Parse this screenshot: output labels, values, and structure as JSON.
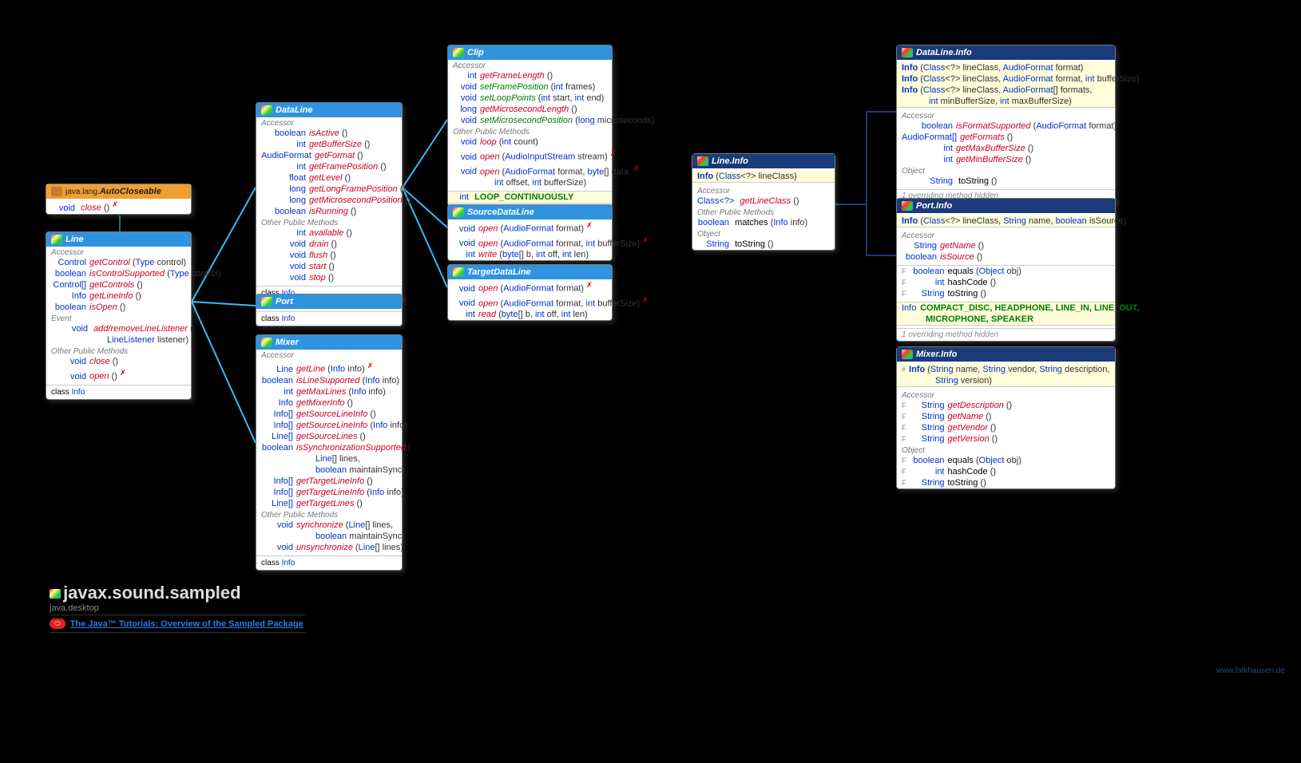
{
  "package": {
    "name": "javax.sound.sampled",
    "module": "java.desktop",
    "tutorial": "The Java™ Tutorials: Overview of the Sampled Package",
    "credit": "www.falkhausen.de"
  },
  "autocloseable": {
    "title_prefix": "java.lang.",
    "title": "AutoCloseable",
    "rows": [
      {
        "rt": "void",
        "nm": "close",
        "args": "()",
        "throws": true
      }
    ]
  },
  "line": {
    "title": "Line",
    "accessor": [
      {
        "rt": "Control",
        "nm": "getControl",
        "args": "(Type control)"
      },
      {
        "rt": "boolean",
        "nm": "isControlSupported",
        "args": "(Type control)"
      },
      {
        "rt": "Control[]",
        "nm": "getControls",
        "args": "()"
      },
      {
        "rt": "Info",
        "nm": "getLineInfo",
        "args": "()"
      },
      {
        "rt": "boolean",
        "nm": "isOpen",
        "args": "()"
      }
    ],
    "event": [
      {
        "rt": "void",
        "nm": "add/removeLineListener",
        "args": "(",
        "cont": "LineListener listener)"
      }
    ],
    "other": [
      {
        "rt": "void",
        "nm": "close",
        "args": "()"
      },
      {
        "rt": "void",
        "nm": "open",
        "args": "()",
        "throws": true
      }
    ],
    "footer": "Info"
  },
  "dataline": {
    "title": "DataLine",
    "accessor": [
      {
        "rt": "boolean",
        "nm": "isActive",
        "args": "()"
      },
      {
        "rt": "int",
        "nm": "getBufferSize",
        "args": "()"
      },
      {
        "rt": "AudioFormat",
        "nm": "getFormat",
        "args": "()"
      },
      {
        "rt": "int",
        "nm": "getFramePosition",
        "args": "()"
      },
      {
        "rt": "float",
        "nm": "getLevel",
        "args": "()"
      },
      {
        "rt": "long",
        "nm": "getLongFramePosition",
        "args": "()"
      },
      {
        "rt": "long",
        "nm": "getMicrosecondPosition",
        "args": "()"
      },
      {
        "rt": "boolean",
        "nm": "isRunning",
        "args": "()"
      }
    ],
    "other": [
      {
        "rt": "int",
        "nm": "available",
        "args": "()"
      },
      {
        "rt": "void",
        "nm": "drain",
        "args": "()"
      },
      {
        "rt": "void",
        "nm": "flush",
        "args": "()"
      },
      {
        "rt": "void",
        "nm": "start",
        "args": "()"
      },
      {
        "rt": "void",
        "nm": "stop",
        "args": "()"
      }
    ],
    "footer": "Info"
  },
  "port": {
    "title": "Port",
    "footer": "Info"
  },
  "mixer": {
    "title": "Mixer",
    "accessor": [
      {
        "rt": "Line",
        "nm": "getLine",
        "args": "(Info info)",
        "throws": true
      },
      {
        "rt": "boolean",
        "nm": "isLineSupported",
        "args": "(Info info)"
      },
      {
        "rt": "int",
        "nm": "getMaxLines",
        "args": "(Info info)"
      },
      {
        "rt": "Info",
        "nm": "getMixerInfo",
        "args": "()"
      },
      {
        "rt": "Info[]",
        "nm": "getSourceLineInfo",
        "args": "()"
      },
      {
        "rt": "Info[]",
        "nm": "getSourceLineInfo",
        "args": "(Info info)"
      },
      {
        "rt": "Line[]",
        "nm": "getSourceLines",
        "args": "()"
      },
      {
        "rt": "boolean",
        "nm": "isSynchronizationSupported",
        "args": "(",
        "cont1": "Line[] lines,",
        "cont2": "boolean maintainSync)"
      },
      {
        "rt": "Info[]",
        "nm": "getTargetLineInfo",
        "args": "()"
      },
      {
        "rt": "Info[]",
        "nm": "getTargetLineInfo",
        "args": "(Info info)"
      },
      {
        "rt": "Line[]",
        "nm": "getTargetLines",
        "args": "()"
      }
    ],
    "other": [
      {
        "rt": "void",
        "nm": "synchronize",
        "args": "(Line[] lines,",
        "cont": "boolean maintainSync)"
      },
      {
        "rt": "void",
        "nm": "unsynchronize",
        "args": "(Line[] lines)"
      }
    ],
    "footer": "Info"
  },
  "clip": {
    "title": "Clip",
    "accessor": [
      {
        "rt": "int",
        "nm": "getFrameLength",
        "args": "()"
      },
      {
        "rt": "void",
        "nm": "setFramePosition",
        "args": "(int frames)",
        "green": true
      },
      {
        "rt": "void",
        "nm": "setLoopPoints",
        "args": "(int start, int end)",
        "green": true
      },
      {
        "rt": "long",
        "nm": "getMicrosecondLength",
        "args": "()"
      },
      {
        "rt": "void",
        "nm": "setMicrosecondPosition",
        "args": "(long microseconds)",
        "green": true
      }
    ],
    "other": [
      {
        "rt": "void",
        "nm": "loop",
        "args": "(int count)"
      },
      {
        "rt": "void",
        "nm": "open",
        "args": "(AudioInputStream stream)",
        "throws": true
      },
      {
        "rt": "void",
        "nm": "open",
        "args": "(AudioFormat format, byte[] data,",
        "cont": "int offset, int bufferSize)",
        "throws": true
      }
    ],
    "const": "LOOP_CONTINUOUSLY",
    "constType": "int"
  },
  "sourcedataline": {
    "title": "SourceDataLine",
    "rows": [
      {
        "rt": "void",
        "nm": "open",
        "args": "(AudioFormat format)",
        "throws": true
      },
      {
        "rt": "void",
        "nm": "open",
        "args": "(AudioFormat format, int bufferSize)",
        "throws": true
      },
      {
        "rt": "int",
        "nm": "write",
        "args": "(byte[] b, int off, int len)"
      }
    ]
  },
  "targetdataline": {
    "title": "TargetDataLine",
    "rows": [
      {
        "rt": "void",
        "nm": "open",
        "args": "(AudioFormat format)",
        "throws": true
      },
      {
        "rt": "void",
        "nm": "open",
        "args": "(AudioFormat format, int bufferSize)",
        "throws": true
      },
      {
        "rt": "int",
        "nm": "read",
        "args": "(byte[] b, int off, int len)"
      }
    ]
  },
  "lineinfo": {
    "title": "Line.Info",
    "ctor": [
      {
        "nm": "Info",
        "args": "(Class<?> lineClass)"
      }
    ],
    "accessor": [
      {
        "rt": "Class<?>",
        "nm": "getLineClass",
        "args": "()"
      }
    ],
    "other": [
      {
        "rt": "boolean",
        "nm": "matches",
        "args": "(Info info)"
      }
    ],
    "object": [
      {
        "rt": "String",
        "nm": "toString",
        "args": "()"
      }
    ]
  },
  "datalineinfo": {
    "title": "DataLine.Info",
    "ctor": [
      {
        "nm": "Info",
        "args": "(Class<?> lineClass, AudioFormat format)"
      },
      {
        "nm": "Info",
        "args": "(Class<?> lineClass, AudioFormat format, int bufferSize)"
      },
      {
        "nm": "Info",
        "args": "(Class<?> lineClass, AudioFormat[] formats,",
        "cont": "int minBufferSize, int maxBufferSize)"
      }
    ],
    "accessor": [
      {
        "rt": "boolean",
        "nm": "isFormatSupported",
        "args": "(AudioFormat format)"
      },
      {
        "rt": "AudioFormat[]",
        "nm": "getFormats",
        "args": "()"
      },
      {
        "rt": "int",
        "nm": "getMaxBufferSize",
        "args": "()"
      },
      {
        "rt": "int",
        "nm": "getMinBufferSize",
        "args": "()"
      }
    ],
    "object": [
      {
        "rt": "String",
        "nm": "toString",
        "args": "()"
      }
    ],
    "hidden": "1 overriding method hidden"
  },
  "portinfo": {
    "title": "Port.Info",
    "ctor": [
      {
        "nm": "Info",
        "args": "(Class<?> lineClass, String name, boolean isSource)"
      }
    ],
    "accessor": [
      {
        "rt": "String",
        "nm": "getName",
        "args": "()"
      },
      {
        "rt": "boolean",
        "nm": "isSource",
        "args": "()"
      }
    ],
    "frows": [
      {
        "mod": "F",
        "rt": "boolean",
        "nm": "equals",
        "args": "(Object obj)",
        "plain": true
      },
      {
        "mod": "F",
        "rt": "int",
        "nm": "hashCode",
        "args": "()",
        "plain": true
      },
      {
        "mod": "F",
        "rt": "String",
        "nm": "toString",
        "args": "()",
        "plain": true
      }
    ],
    "const_line1": "COMPACT_DISC, HEADPHONE, LINE_IN, LINE_OUT,",
    "const_line2": "MICROPHONE, SPEAKER",
    "constType": "Info",
    "hidden": "1 overriding method hidden"
  },
  "mixerinfo": {
    "title": "Mixer.Info",
    "ctor": [
      {
        "mod": "#",
        "nm": "Info",
        "args": "(String name, String vendor, String description,",
        "cont": "String version)"
      }
    ],
    "accessor": [
      {
        "mod": "F",
        "rt": "String",
        "nm": "getDescription",
        "args": "()"
      },
      {
        "mod": "F",
        "rt": "String",
        "nm": "getName",
        "args": "()"
      },
      {
        "mod": "F",
        "rt": "String",
        "nm": "getVendor",
        "args": "()"
      },
      {
        "mod": "F",
        "rt": "String",
        "nm": "getVersion",
        "args": "()"
      }
    ],
    "object": [
      {
        "mod": "F",
        "rt": "boolean",
        "nm": "equals",
        "args": "(Object obj)",
        "plain": true
      },
      {
        "mod": "F",
        "rt": "int",
        "nm": "hashCode",
        "args": "()",
        "plain": true
      },
      {
        "mod": "F",
        "rt": "String",
        "nm": "toString",
        "args": "()",
        "plain": true
      }
    ]
  },
  "labels": {
    "accessor": "Accessor",
    "event": "Event",
    "other": "Other Public Methods",
    "object": "Object",
    "class": "class"
  }
}
